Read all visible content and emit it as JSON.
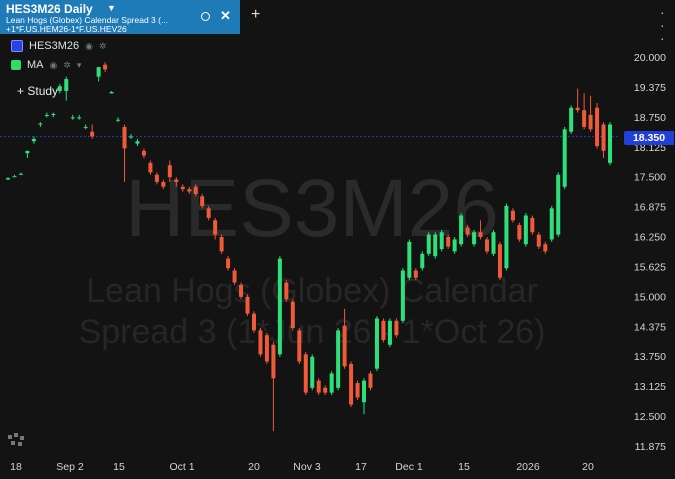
{
  "tab": {
    "title": "HES3M26 Daily",
    "subtitle_line1": "Lean Hogs (Globex) Calendar Spread 3 (...",
    "subtitle_line2": "+1*F.US.HEM26-1*F.US.HEV26"
  },
  "legend": [
    {
      "label": "HES3M26",
      "color": "#2a3fe6"
    },
    {
      "label": "MA",
      "color": "#2edc6c"
    }
  ],
  "study_label": "Study",
  "watermark": {
    "symbol": "HES3M26",
    "line1": "Lean Hogs (Globex) Calendar",
    "line2": "Spread 3 (1*Jun 26 - 1*Oct 26)"
  },
  "price_badge": "18.350",
  "colors": {
    "up": "#2ee07a",
    "down": "#ee5a3a",
    "price_line": "#2140d9",
    "tab": "#1f7ab8"
  },
  "chart_data": {
    "type": "candlestick",
    "yticks": [
      "20.000",
      "19.375",
      "18.750",
      "18.125",
      "17.500",
      "16.875",
      "16.250",
      "15.625",
      "15.000",
      "14.375",
      "13.750",
      "13.125",
      "12.500",
      "11.875"
    ],
    "xticks": [
      "18",
      "Sep 2",
      "15",
      "Oct 1",
      "20",
      "Nov 3",
      "17",
      "Dec 1",
      "15",
      "2026",
      "20"
    ],
    "ylim": [
      11.875,
      20.0
    ],
    "last_price": 18.35,
    "candles": [
      {
        "o": 17.45,
        "h": 17.5,
        "l": 17.45,
        "c": 17.48
      },
      {
        "o": 17.5,
        "h": 17.55,
        "l": 17.5,
        "c": 17.52
      },
      {
        "o": 17.55,
        "h": 17.6,
        "l": 17.55,
        "c": 17.57
      },
      {
        "o": 18.0,
        "h": 18.05,
        "l": 17.9,
        "c": 18.05
      },
      {
        "o": 18.25,
        "h": 18.35,
        "l": 18.2,
        "c": 18.3
      },
      {
        "o": 18.6,
        "h": 18.65,
        "l": 18.55,
        "c": 18.62
      },
      {
        "o": 18.8,
        "h": 18.85,
        "l": 18.75,
        "c": 18.8
      },
      {
        "o": 18.8,
        "h": 18.85,
        "l": 18.75,
        "c": 18.82
      },
      {
        "o": 19.3,
        "h": 19.45,
        "l": 19.25,
        "c": 19.4
      },
      {
        "o": 19.3,
        "h": 19.6,
        "l": 19.1,
        "c": 19.55
      },
      {
        "o": 18.75,
        "h": 18.8,
        "l": 18.7,
        "c": 18.75
      },
      {
        "o": 18.75,
        "h": 18.8,
        "l": 18.7,
        "c": 18.75
      },
      {
        "o": 18.55,
        "h": 18.6,
        "l": 18.5,
        "c": 18.55
      },
      {
        "o": 18.45,
        "h": 18.6,
        "l": 18.3,
        "c": 18.35
      },
      {
        "o": 19.6,
        "h": 19.8,
        "l": 19.5,
        "c": 19.8
      },
      {
        "o": 19.85,
        "h": 19.9,
        "l": 19.7,
        "c": 19.75
      },
      {
        "o": 19.25,
        "h": 19.3,
        "l": 19.25,
        "c": 19.28
      },
      {
        "o": 18.7,
        "h": 18.75,
        "l": 18.65,
        "c": 18.7
      },
      {
        "o": 18.55,
        "h": 18.6,
        "l": 17.4,
        "c": 18.1
      },
      {
        "o": 18.35,
        "h": 18.4,
        "l": 18.3,
        "c": 18.35
      },
      {
        "o": 18.2,
        "h": 18.3,
        "l": 18.15,
        "c": 18.25
      },
      {
        "o": 18.05,
        "h": 18.1,
        "l": 17.9,
        "c": 17.95
      },
      {
        "o": 17.8,
        "h": 17.85,
        "l": 17.55,
        "c": 17.6
      },
      {
        "o": 17.55,
        "h": 17.6,
        "l": 17.35,
        "c": 17.4
      },
      {
        "o": 17.4,
        "h": 17.45,
        "l": 17.25,
        "c": 17.3
      },
      {
        "o": 17.75,
        "h": 17.85,
        "l": 17.4,
        "c": 17.5
      },
      {
        "o": 17.45,
        "h": 17.5,
        "l": 17.3,
        "c": 17.4
      },
      {
        "o": 17.3,
        "h": 17.35,
        "l": 17.2,
        "c": 17.25
      },
      {
        "o": 17.25,
        "h": 17.3,
        "l": 17.15,
        "c": 17.2
      },
      {
        "o": 17.3,
        "h": 17.35,
        "l": 17.1,
        "c": 17.15
      },
      {
        "o": 17.1,
        "h": 17.15,
        "l": 16.85,
        "c": 16.9
      },
      {
        "o": 16.85,
        "h": 16.9,
        "l": 16.6,
        "c": 16.65
      },
      {
        "o": 16.6,
        "h": 16.65,
        "l": 16.2,
        "c": 16.3
      },
      {
        "o": 16.25,
        "h": 16.3,
        "l": 15.9,
        "c": 15.95
      },
      {
        "o": 15.8,
        "h": 15.85,
        "l": 15.55,
        "c": 15.6
      },
      {
        "o": 15.55,
        "h": 15.6,
        "l": 15.25,
        "c": 15.3
      },
      {
        "o": 15.25,
        "h": 15.3,
        "l": 14.95,
        "c": 15.0
      },
      {
        "o": 15.0,
        "h": 15.05,
        "l": 14.6,
        "c": 14.65
      },
      {
        "o": 14.65,
        "h": 14.7,
        "l": 14.25,
        "c": 14.3
      },
      {
        "o": 14.3,
        "h": 14.35,
        "l": 13.75,
        "c": 13.8
      },
      {
        "o": 14.2,
        "h": 14.25,
        "l": 13.6,
        "c": 13.65
      },
      {
        "o": 14.0,
        "h": 14.05,
        "l": 12.2,
        "c": 13.3
      },
      {
        "o": 13.8,
        "h": 15.85,
        "l": 13.75,
        "c": 15.8
      },
      {
        "o": 15.3,
        "h": 15.35,
        "l": 14.9,
        "c": 14.95
      },
      {
        "o": 14.9,
        "h": 14.95,
        "l": 14.3,
        "c": 14.35
      },
      {
        "o": 14.3,
        "h": 14.35,
        "l": 13.6,
        "c": 13.65
      },
      {
        "o": 13.8,
        "h": 13.85,
        "l": 12.95,
        "c": 13.0
      },
      {
        "o": 13.1,
        "h": 13.8,
        "l": 13.05,
        "c": 13.75
      },
      {
        "o": 13.25,
        "h": 13.3,
        "l": 12.95,
        "c": 13.0
      },
      {
        "o": 13.1,
        "h": 13.15,
        "l": 12.95,
        "c": 13.0
      },
      {
        "o": 13.0,
        "h": 13.45,
        "l": 12.95,
        "c": 13.4
      },
      {
        "o": 13.1,
        "h": 14.35,
        "l": 13.05,
        "c": 14.3
      },
      {
        "o": 14.4,
        "h": 14.75,
        "l": 13.5,
        "c": 13.55
      },
      {
        "o": 13.6,
        "h": 13.65,
        "l": 12.7,
        "c": 12.75
      },
      {
        "o": 13.2,
        "h": 13.25,
        "l": 12.85,
        "c": 12.9
      },
      {
        "o": 12.8,
        "h": 13.3,
        "l": 12.55,
        "c": 13.25
      },
      {
        "o": 13.4,
        "h": 13.45,
        "l": 13.05,
        "c": 13.1
      },
      {
        "o": 13.5,
        "h": 14.6,
        "l": 13.45,
        "c": 14.55
      },
      {
        "o": 14.5,
        "h": 14.55,
        "l": 14.05,
        "c": 14.1
      },
      {
        "o": 14.0,
        "h": 14.55,
        "l": 13.95,
        "c": 14.5
      },
      {
        "o": 14.5,
        "h": 14.55,
        "l": 14.15,
        "c": 14.2
      },
      {
        "o": 14.5,
        "h": 15.6,
        "l": 14.45,
        "c": 15.55
      },
      {
        "o": 15.4,
        "h": 16.2,
        "l": 15.35,
        "c": 16.15
      },
      {
        "o": 15.55,
        "h": 15.6,
        "l": 15.35,
        "c": 15.4
      },
      {
        "o": 15.6,
        "h": 15.95,
        "l": 15.55,
        "c": 15.9
      },
      {
        "o": 15.9,
        "h": 16.35,
        "l": 15.85,
        "c": 16.3
      },
      {
        "o": 15.85,
        "h": 16.35,
        "l": 15.8,
        "c": 16.3
      },
      {
        "o": 16.0,
        "h": 16.4,
        "l": 15.95,
        "c": 16.35
      },
      {
        "o": 16.25,
        "h": 16.3,
        "l": 16.0,
        "c": 16.05
      },
      {
        "o": 15.95,
        "h": 16.25,
        "l": 15.9,
        "c": 16.2
      },
      {
        "o": 16.1,
        "h": 16.75,
        "l": 16.05,
        "c": 16.7
      },
      {
        "o": 16.45,
        "h": 16.5,
        "l": 16.25,
        "c": 16.3
      },
      {
        "o": 16.1,
        "h": 16.4,
        "l": 16.05,
        "c": 16.35
      },
      {
        "o": 16.35,
        "h": 16.6,
        "l": 16.2,
        "c": 16.25
      },
      {
        "o": 16.2,
        "h": 16.25,
        "l": 15.9,
        "c": 15.95
      },
      {
        "o": 15.9,
        "h": 16.4,
        "l": 15.85,
        "c": 16.35
      },
      {
        "o": 16.1,
        "h": 16.15,
        "l": 15.35,
        "c": 15.4
      },
      {
        "o": 15.6,
        "h": 16.95,
        "l": 15.55,
        "c": 16.9
      },
      {
        "o": 16.8,
        "h": 16.85,
        "l": 16.55,
        "c": 16.6
      },
      {
        "o": 16.5,
        "h": 16.55,
        "l": 16.15,
        "c": 16.2
      },
      {
        "o": 16.1,
        "h": 16.75,
        "l": 16.05,
        "c": 16.7
      },
      {
        "o": 16.65,
        "h": 16.7,
        "l": 16.3,
        "c": 16.35
      },
      {
        "o": 16.3,
        "h": 16.35,
        "l": 16.0,
        "c": 16.05
      },
      {
        "o": 16.1,
        "h": 16.15,
        "l": 15.9,
        "c": 15.95
      },
      {
        "o": 16.2,
        "h": 16.9,
        "l": 16.15,
        "c": 16.85
      },
      {
        "o": 16.3,
        "h": 17.6,
        "l": 16.25,
        "c": 17.55
      },
      {
        "o": 17.3,
        "h": 18.55,
        "l": 17.25,
        "c": 18.5
      },
      {
        "o": 18.45,
        "h": 19.0,
        "l": 18.4,
        "c": 18.95
      },
      {
        "o": 18.95,
        "h": 19.35,
        "l": 18.85,
        "c": 18.9
      },
      {
        "o": 18.9,
        "h": 19.25,
        "l": 18.5,
        "c": 18.55
      },
      {
        "o": 18.8,
        "h": 19.2,
        "l": 18.45,
        "c": 18.5
      },
      {
        "o": 18.95,
        "h": 19.05,
        "l": 18.1,
        "c": 18.15
      },
      {
        "o": 18.6,
        "h": 18.65,
        "l": 17.9,
        "c": 18.05
      },
      {
        "o": 17.8,
        "h": 18.65,
        "l": 17.75,
        "c": 18.6
      }
    ]
  }
}
